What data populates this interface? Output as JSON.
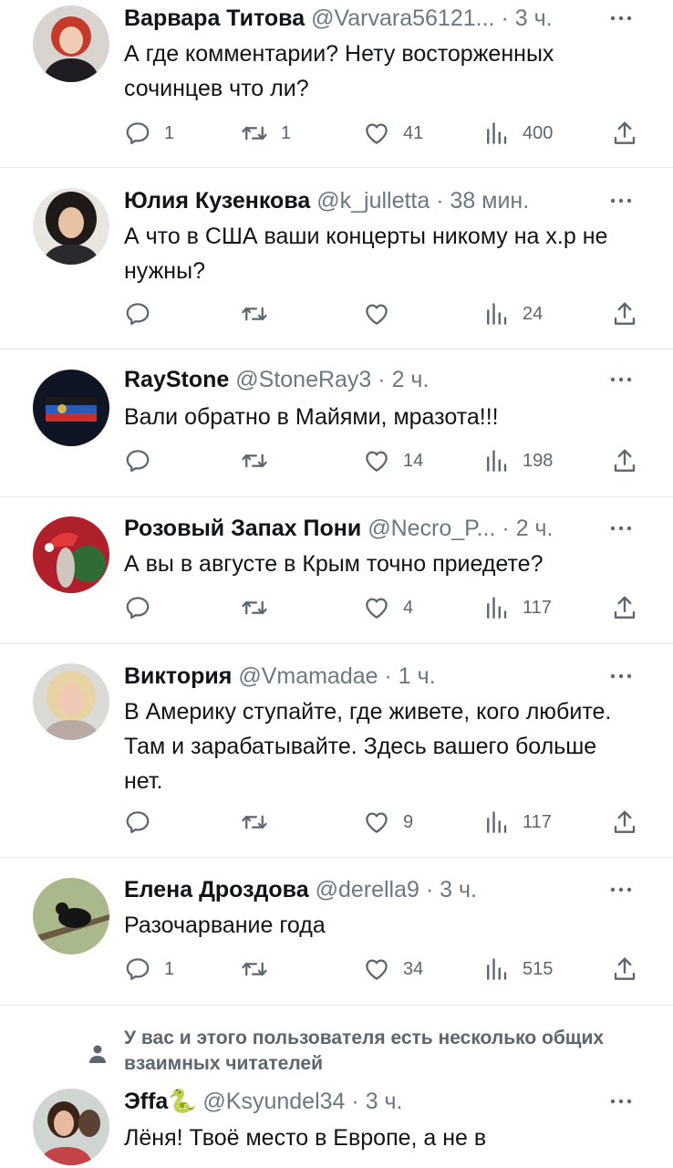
{
  "tweets": [
    {
      "name": "Варвара Титова",
      "handle": "@Varvara56121...",
      "time": "3 ч.",
      "text": "А где комментарии? Нету восторженных сочинцев что ли?",
      "replies": "1",
      "retweets": "1",
      "likes": "41",
      "views": "400"
    },
    {
      "name": "Юлия Кузенкова",
      "handle": "@k_julletta",
      "time": "38 мин.",
      "text": "А что в США ваши концерты никому на х.р не нужны?",
      "replies": "",
      "retweets": "",
      "likes": "",
      "views": "24"
    },
    {
      "name": "RayStone",
      "handle": "@StoneRay3",
      "time": "2 ч.",
      "text": "Вали обратно в Майями, мразота!!!",
      "replies": "",
      "retweets": "",
      "likes": "14",
      "views": "198"
    },
    {
      "name": "Розовый Запах Пони",
      "handle": "@Necro_P...",
      "time": "2 ч.",
      "text": "А вы в августе в Крым точно приедете?",
      "replies": "",
      "retweets": "",
      "likes": "4",
      "views": "117"
    },
    {
      "name": "Виктория",
      "handle": "@Vmamadae",
      "time": "1 ч.",
      "text": "В Америку ступайте, где живете, кого любите. Там и зарабатывайте. Здесь вашего больше нет.",
      "replies": "",
      "retweets": "",
      "likes": "9",
      "views": "117"
    },
    {
      "name": "Елена Дроздова",
      "handle": "@derella9",
      "time": "3 ч.",
      "text": "Разочарвание года",
      "replies": "1",
      "retweets": "",
      "likes": "34",
      "views": "515"
    },
    {
      "name": "Эffa🐍",
      "handle": "@Ksyundel34",
      "time": "3 ч.",
      "text": "Лёня! Твоё место в Европе, а не в"
    }
  ],
  "separator": "·",
  "mutual_note": "У вас и этого пользователя есть несколько общих взаимных читателей",
  "icons": {
    "reply": "reply-icon",
    "retweet": "retweet-icon",
    "like": "heart-icon",
    "views": "views-icon",
    "share": "share-icon",
    "more": "more-dots-icon",
    "person": "person-icon"
  },
  "colors": {
    "text": "#0f1419",
    "secondary": "#6a7884",
    "divider": "#e4e8eb"
  }
}
